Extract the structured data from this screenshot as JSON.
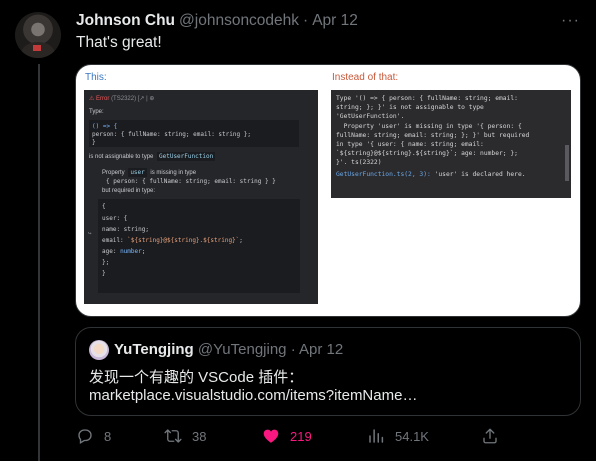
{
  "tweet": {
    "author_name": "Johnson Chu",
    "author_handle": "@johnsoncodehk",
    "separator": "·",
    "date": "Apr 12",
    "more_label": "···",
    "text": "That's great!"
  },
  "media": {
    "left_label": "This:",
    "right_label": "Instead of that:",
    "left_panel": {
      "error_label": "⚠ Error",
      "error_code": "(TS2322)",
      "error_icons": "[↗ | ⊕",
      "type_label": "Type:",
      "type_line1": "() => {",
      "type_line2": "  person: { fullName: string; email: string };",
      "type_line3": "}",
      "not_assignable_text": "is not assignable to type",
      "target_type": "GetUserFunction",
      "property_prefix": "Property",
      "property_name": "user",
      "property_suffix": "is missing in type",
      "missing_type": "{ person: { fullName: string; email: string } }",
      "but_required": "but required in type:",
      "req_line1": "{",
      "req_line2": "  user: {",
      "req_line3": "    name: string;",
      "req_line4a": "    email: ",
      "req_line4b": "`${string}@${string}.${string}`",
      "req_line4c": ";",
      "req_line5a": "    age: ",
      "req_line5b": "number",
      "req_line5c": ";",
      "req_line6": "  };",
      "req_line7": "}",
      "arrow": "↪"
    },
    "right_panel": {
      "lines": [
        "Type '() => { person: { fullName: string; email:",
        "string; }; }' is not assignable to type",
        "'GetUserFunction'.",
        "  Property 'user' is missing in type '{ person: {",
        "fullName: string; email: string; }; }' but required",
        "in type '{ user: { name: string; email:",
        "`${string}@${string}.${string}`; age: number; };",
        "}'. ts(2322)"
      ],
      "link_text": "GetUserFunction.ts(2, 3):",
      "link_suffix": " 'user' is declared here."
    }
  },
  "quote": {
    "author_name": "YuTengjing",
    "author_handle": "@YuTengjing",
    "separator": "·",
    "date": "Apr 12",
    "line1": "发现一个有趣的 VSCode 插件：",
    "line2": "marketplace.visualstudio.com/items?itemName…"
  },
  "actions": {
    "replies": "8",
    "retweets": "38",
    "likes": "219",
    "views": "54.1K"
  },
  "colors": {
    "background": "#000000",
    "text": "#e7e9ea",
    "muted": "#71767b",
    "like": "#f91880",
    "border": "#2f3336"
  }
}
